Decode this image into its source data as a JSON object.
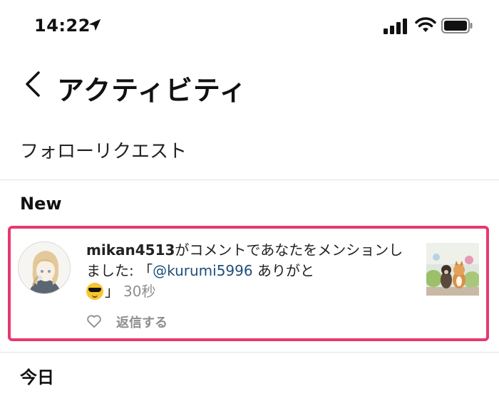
{
  "status_bar": {
    "time": "14:22",
    "icons": [
      "location-arrow-icon",
      "cellular-signal-icon",
      "wifi-icon",
      "battery-icon"
    ]
  },
  "header": {
    "back_icon": "chevron-left-icon",
    "title": "アクティビティ"
  },
  "follow_requests": {
    "label": "フォローリクエスト"
  },
  "sections": {
    "new": "New",
    "today": "今日"
  },
  "notification": {
    "username": "mikan4513",
    "text_before_mention": "がコメントであなたをメンションしました: 「",
    "mention": "@kurumi5996",
    "text_after_mention": " ありがと",
    "emoji": "sunglasses-emoji",
    "closing": "」",
    "timestamp": "30秒",
    "like_icon": "heart-outline-icon",
    "reply_label": "返信する",
    "highlight_color": "#e8386e"
  },
  "colors": {
    "mention": "#1f4f7a",
    "secondary_text": "#8e8e8e"
  }
}
